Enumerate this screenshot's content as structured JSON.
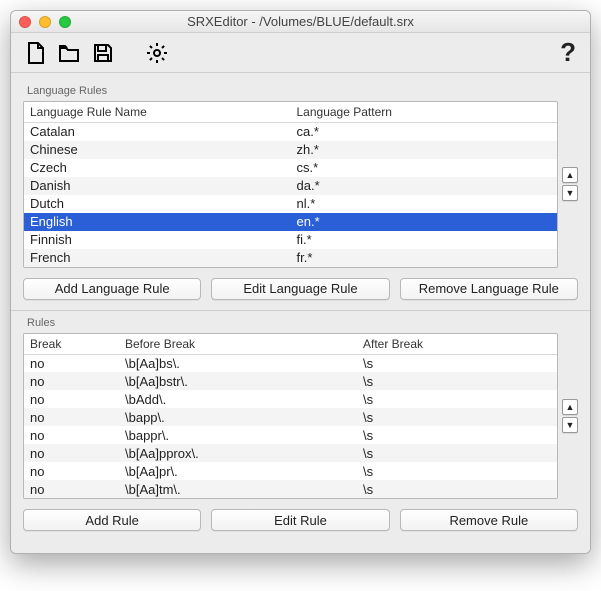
{
  "window": {
    "title": "SRXEditor - /Volumes/BLUE/default.srx"
  },
  "lang_section": {
    "label": "Language Rules",
    "headers": {
      "name": "Language Rule Name",
      "pattern": "Language Pattern"
    },
    "rows": [
      {
        "name": "Catalan",
        "pattern": "ca.*",
        "selected": false
      },
      {
        "name": "Chinese",
        "pattern": "zh.*",
        "selected": false
      },
      {
        "name": "Czech",
        "pattern": "cs.*",
        "selected": false
      },
      {
        "name": "Danish",
        "pattern": "da.*",
        "selected": false
      },
      {
        "name": "Dutch",
        "pattern": "nl.*",
        "selected": false
      },
      {
        "name": "English",
        "pattern": "en.*",
        "selected": true
      },
      {
        "name": "Finnish",
        "pattern": "fi.*",
        "selected": false
      },
      {
        "name": "French",
        "pattern": "fr.*",
        "selected": false
      }
    ],
    "buttons": {
      "add": "Add Language Rule",
      "edit": "Edit Language Rule",
      "remove": "Remove Language Rule"
    }
  },
  "rules_section": {
    "label": "Rules",
    "headers": {
      "break": "Break",
      "before": "Before Break",
      "after": "After Break"
    },
    "rows": [
      {
        "break": "no",
        "before": "\\b[Aa]bs\\.",
        "after": "\\s"
      },
      {
        "break": "no",
        "before": "\\b[Aa]bstr\\.",
        "after": "\\s"
      },
      {
        "break": "no",
        "before": "\\bAdd\\.",
        "after": "\\s"
      },
      {
        "break": "no",
        "before": "\\bapp\\.",
        "after": "\\s"
      },
      {
        "break": "no",
        "before": "\\bappr\\.",
        "after": "\\s"
      },
      {
        "break": "no",
        "before": "\\b[Aa]pprox\\.",
        "after": "\\s"
      },
      {
        "break": "no",
        "before": "\\b[Aa]pr\\.",
        "after": "\\s"
      },
      {
        "break": "no",
        "before": "\\b[Aa]tm\\.",
        "after": "\\s"
      }
    ],
    "buttons": {
      "add": "Add Rule",
      "edit": "Edit Rule",
      "remove": "Remove Rule"
    }
  },
  "glyphs": {
    "up": "▲",
    "down": "▼",
    "help": "?"
  }
}
